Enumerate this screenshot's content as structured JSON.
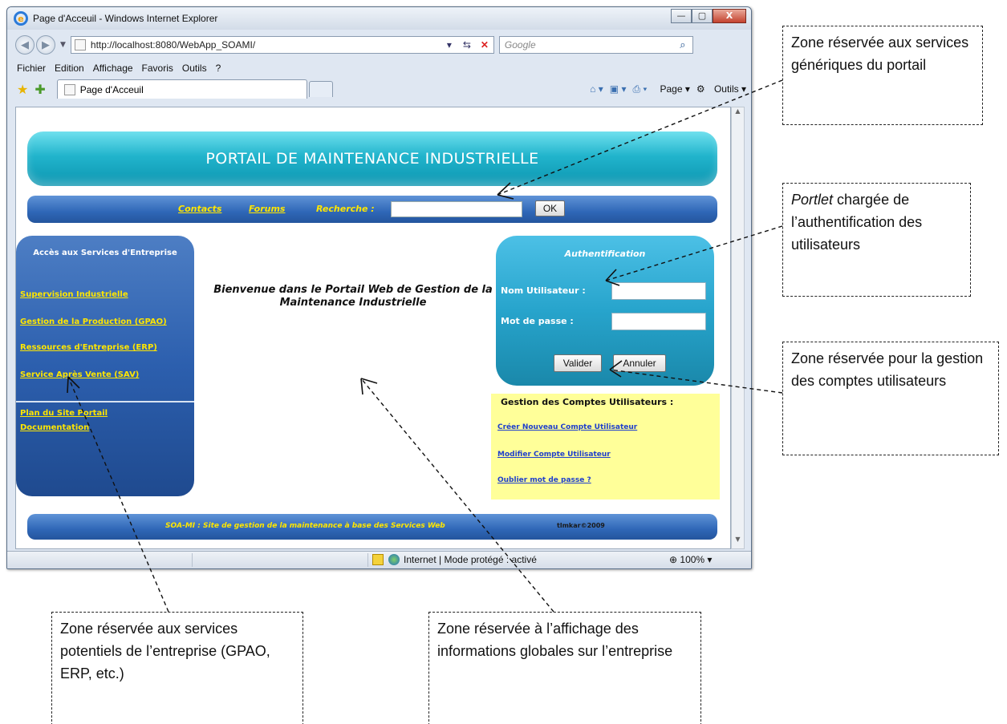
{
  "window": {
    "title": "Page d'Acceuil - Windows Internet Explorer",
    "logo": "e",
    "controls": [
      "—",
      "▢",
      "X"
    ]
  },
  "address_bar": {
    "url": "http://localhost:8080/WebApp_SOAMI/"
  },
  "search_bar": {
    "placeholder": "Google"
  },
  "menu": {
    "items": [
      "Fichier",
      "Edition",
      "Affichage",
      "Favoris",
      "Outils",
      "?"
    ]
  },
  "tab": {
    "label": "Page d'Acceuil"
  },
  "command_bar": {
    "page_label": "Page",
    "tools_label": "Outils"
  },
  "status_bar": {
    "zone_text": "Internet | Mode protégé : activé",
    "zoom": "100%"
  },
  "page": {
    "banner_title": "PORTAIL DE MAINTENANCE INDUSTRIELLE",
    "nav": {
      "contacts": "Contacts",
      "forums": "Forums",
      "search_label": "Recherche :",
      "ok_label": "OK"
    },
    "sidebar": {
      "title": "Accès aux Services d'Entreprise",
      "items": [
        "Supervision Industrielle",
        "Gestion de la Production (GPAO)",
        "Ressources d'Entreprise (ERP)",
        "Service Après Vente (SAV)"
      ],
      "bottom_items": [
        "Plan du Site Portail",
        "Documentation"
      ]
    },
    "welcome": "Bienvenue dans le Portail Web de Gestion de la Maintenance Industrielle",
    "auth": {
      "title": "Authentification",
      "username_label": "Nom Utilisateur :",
      "password_label": "Mot de passe :",
      "validate_label": "Valider",
      "cancel_label": "Annuler"
    },
    "accounts": {
      "title": "Gestion des Comptes Utilisateurs :",
      "links": [
        "Créer Nouveau Compte Utilisateur",
        "Modifier Compte Utilisateur",
        "Oublier mot de passe ?"
      ]
    },
    "footer": {
      "text": "SOA-MI : Site de gestion de la maintenance à base des Services Web",
      "copyright": "tlmkar©2009"
    }
  },
  "callouts": {
    "generic_services": "Zone réservée aux services génériques du portail",
    "portlet_word": "Portlet",
    "portlet_rest": " chargée de l’authentification des utilisateurs",
    "accounts_zone": "Zone réservée pour la gestion des comptes utilisateurs",
    "enterprise_services": "Zone réservée aux services potentiels de l’entreprise (GPAO, ERP, etc.)",
    "global_info": "Zone réservée à l’affichage des informations globales sur l’entreprise"
  }
}
